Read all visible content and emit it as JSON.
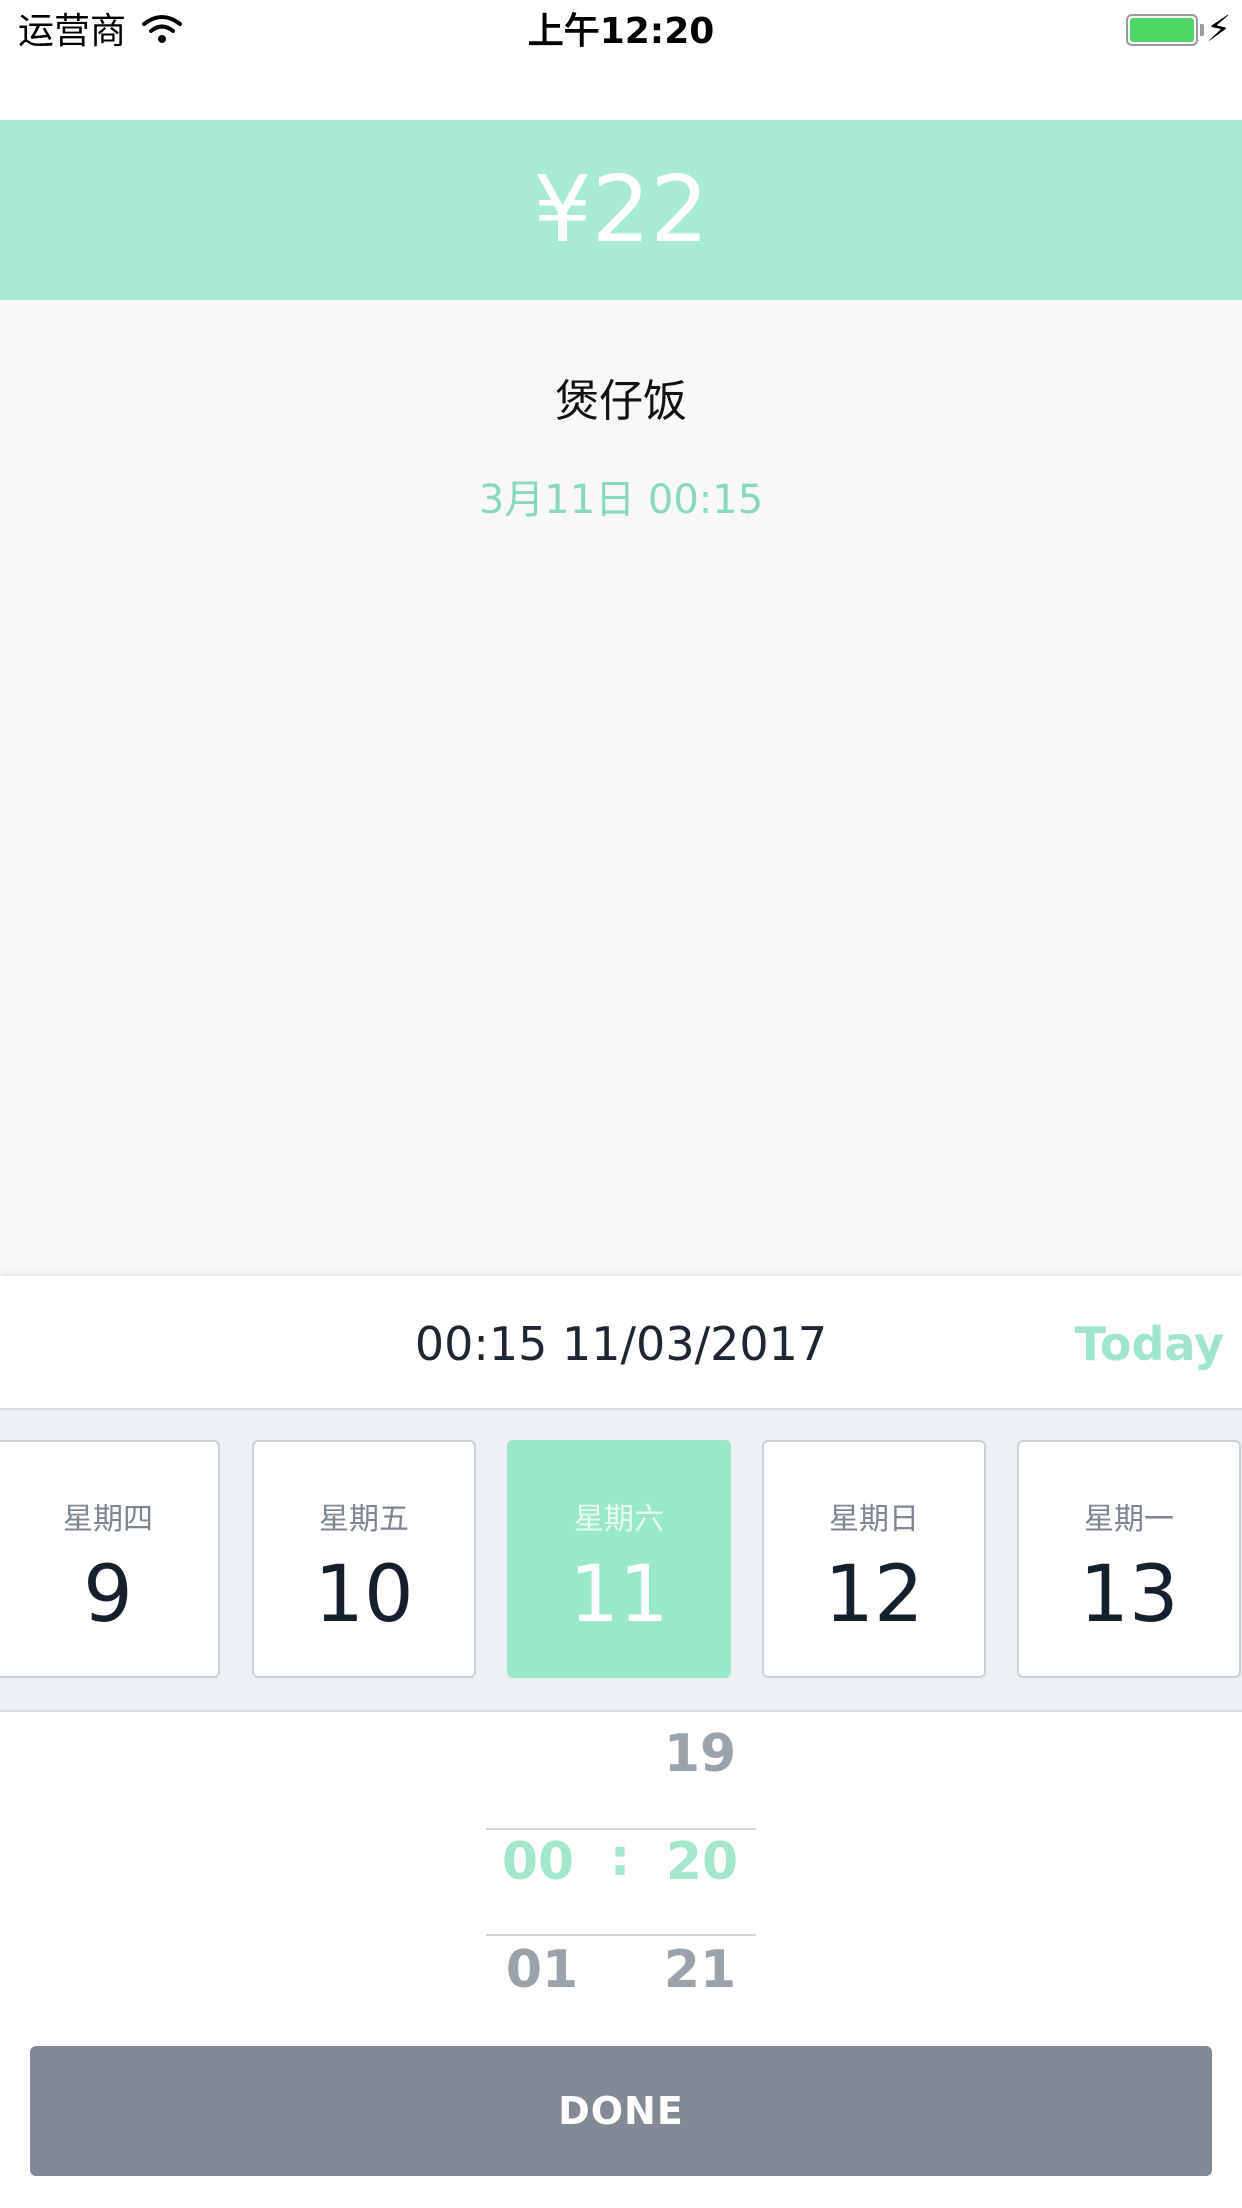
{
  "status_bar": {
    "carrier": "运营商",
    "time": "上午12:20",
    "wifi_icon": "wifi-icon",
    "battery_icon": "battery-icon",
    "charging_icon": "charging-bolt-icon",
    "battery_color": "#4cd964"
  },
  "order": {
    "price": "¥22",
    "name": "煲仔饭",
    "datetime": "3月11日 00:15"
  },
  "picker": {
    "selected_datetime": "00:15 11/03/2017",
    "today_label": "Today",
    "days": [
      {
        "weekday": "星期四",
        "day": "9"
      },
      {
        "weekday": "星期五",
        "day": "10"
      },
      {
        "weekday": "星期六",
        "day": "11"
      },
      {
        "weekday": "星期日",
        "day": "12"
      },
      {
        "weekday": "星期一",
        "day": "13"
      }
    ],
    "time_wheel": {
      "minute_prev": "19",
      "hour_selected": "00",
      "separator": ":",
      "minute_selected": "20",
      "hour_next": "01",
      "minute_next": "21"
    },
    "done_label": "DONE"
  },
  "colors": {
    "accent": "#99e8c9",
    "price_banner": "#a8ebd4",
    "date_text": "#86d9be",
    "done_button": "#818a94"
  }
}
